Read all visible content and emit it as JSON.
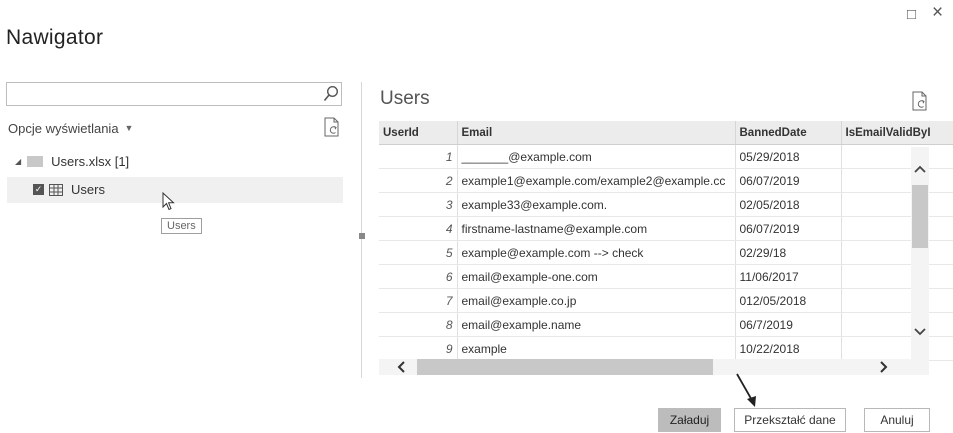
{
  "window": {
    "title": "Nawigator",
    "maximize_glyph": "□",
    "close_glyph": "×"
  },
  "left_panel": {
    "search": {
      "value": "",
      "placeholder": "",
      "icon": "search-icon"
    },
    "display_options": {
      "label": "Opcje wyświetlania",
      "caret": "▼"
    },
    "refresh_icon": "refresh-icon",
    "tree": {
      "file": {
        "label": "Users.xlsx [1]",
        "expand_glyph": "◢"
      },
      "items": [
        {
          "label": "Users",
          "checked": true
        }
      ]
    },
    "tooltip": "Users"
  },
  "preview": {
    "title": "Users",
    "columns": [
      "UserId",
      "Email",
      "BannedDate",
      "IsEmailValidByI"
    ],
    "rows": [
      [
        "1",
        "_______@example.com",
        "05/29/2018",
        ""
      ],
      [
        "2",
        "example1@example.com/example2@example.cc",
        "06/07/2019",
        ""
      ],
      [
        "3",
        "example33@example.com.",
        "02/05/2018",
        ""
      ],
      [
        "4",
        "firstname-lastname@example.com",
        "06/07/2019",
        ""
      ],
      [
        "5",
        "example@example.com --> check",
        "02/29/18",
        ""
      ],
      [
        "6",
        "email@example-one.com",
        "11/06/2017",
        ""
      ],
      [
        "7",
        "email@example.co.jp",
        "012/05/2018",
        ""
      ],
      [
        "8",
        "email@example.name",
        "06/7/2019",
        ""
      ],
      [
        "9",
        "example",
        "10/22/2018",
        ""
      ]
    ],
    "scroll_up": "^",
    "scroll_down": "v",
    "scroll_left": "<",
    "scroll_right": ">"
  },
  "footer": {
    "load_label": "Załaduj",
    "transform_label": "Przekształć dane",
    "cancel_label": "Anuluj"
  }
}
